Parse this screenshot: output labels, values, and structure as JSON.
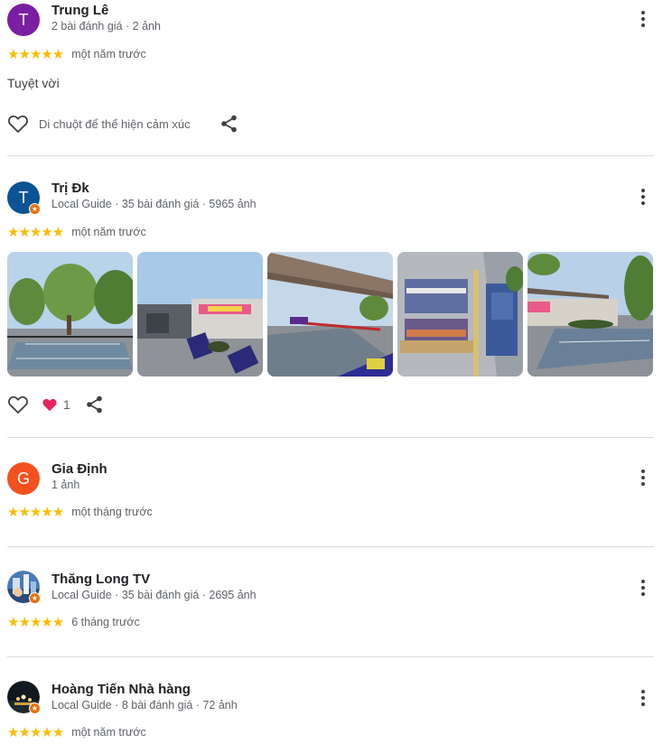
{
  "reviews": [
    {
      "avatar_letter": "T",
      "avatar_color": "#7b1fa2",
      "name": "Trung Lê",
      "meta": "2 bài đánh giá · 2 ảnh",
      "stars": "★★★★★",
      "time": "một năm trước",
      "text": "Tuyệt vời",
      "reaction_label": "Di chuột để thể hiện cảm xúc"
    },
    {
      "avatar_letter": "T",
      "avatar_color": "#0b5394",
      "name": "Trị Đk",
      "meta": "Local Guide · 35 bài đánh giá · 5965 ảnh",
      "stars": "★★★★★",
      "time": "một năm trước",
      "photos": [
        {
          "label": "pickleball-court-trees"
        },
        {
          "label": "pickleball-clubhouse"
        },
        {
          "label": "covered-court-walkway"
        },
        {
          "label": "aerial-court-layout"
        },
        {
          "label": "court-with-seating"
        }
      ],
      "heart_count": "1"
    },
    {
      "avatar_letter": "G",
      "avatar_color": "#f4511e",
      "name": "Gia Định",
      "meta": "1 ảnh",
      "stars": "★★★★★",
      "time": "một tháng trước"
    },
    {
      "name": "Thăng Long TV",
      "meta": "Local Guide · 35 bài đánh giá · 2695 ảnh",
      "stars": "★★★★★",
      "time": "6 tháng trước"
    },
    {
      "name": "Hoàng Tiến Nhà hàng",
      "meta": "Local Guide · 8 bài đánh giá · 72 ảnh",
      "stars": "★★★★★",
      "time": "một năm trước"
    }
  ],
  "colors": {
    "star": "#fbbc04",
    "heart_reaction": "#e8245c",
    "divider": "#dadce0"
  }
}
